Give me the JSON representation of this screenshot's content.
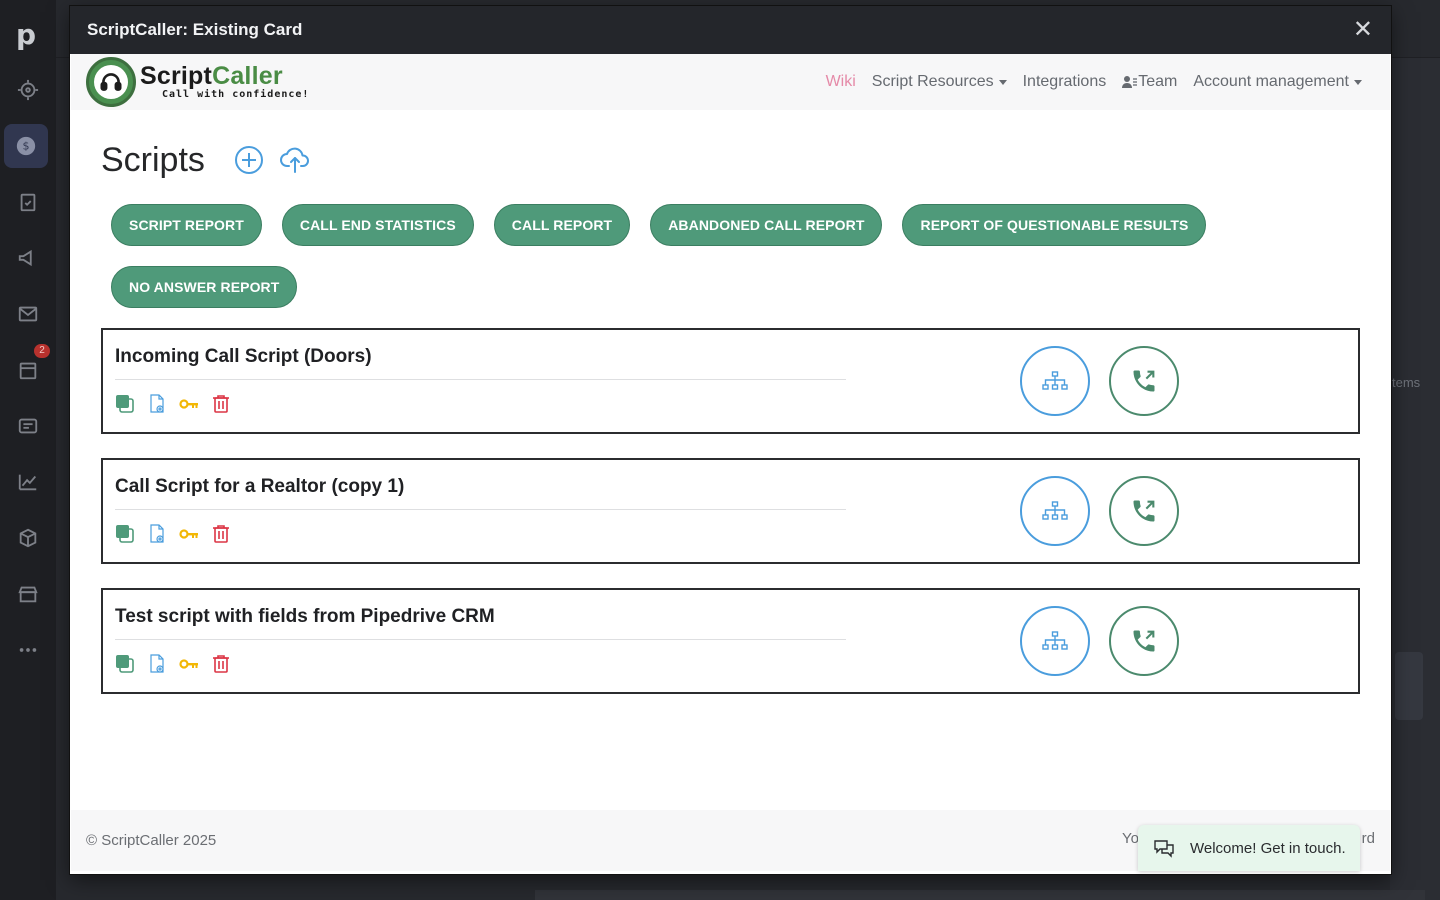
{
  "background": {
    "logo": "p",
    "badge": "2",
    "right_text": "tems"
  },
  "modal": {
    "title": "ScriptCaller: Existing Card",
    "close": "✕"
  },
  "brand": {
    "name_a": "Script",
    "name_b": "Caller",
    "tagline": "Call with confidence!"
  },
  "nav": {
    "wiki": "Wiki",
    "script_resources": "Script Resources",
    "integrations": "Integrations",
    "team": "Team",
    "account": "Account management"
  },
  "page": {
    "title": "Scripts"
  },
  "reports": [
    "SCRIPT REPORT",
    "CALL END STATISTICS",
    "CALL REPORT",
    "ABANDONED CALL REPORT",
    "REPORT OF QUESTIONABLE RESULTS",
    "NO ANSWER REPORT"
  ],
  "scripts": [
    {
      "title": "Incoming Call Script (Doors)"
    },
    {
      "title": "Call Script for a Realtor (copy 1)"
    },
    {
      "title": "Test script with fields from Pipedrive CRM"
    }
  ],
  "footer": {
    "copyright": "© ScriptCaller 2025",
    "left_fragment": "Yo",
    "right_fragment": "rd"
  },
  "chat": {
    "text": "Welcome! Get in touch."
  },
  "colors": {
    "report_button": "#4f9a7a",
    "flow_button_border": "#4a9ddd",
    "call_button_border": "#4b8a6d",
    "wiki_link": "#e58aa8",
    "delete_icon": "#dc3545",
    "key_icon": "#f2b705"
  },
  "icons": {
    "add": "plus-circle-icon",
    "upload": "cloud-upload-icon",
    "copy": "copy-icon",
    "file": "file-settings-icon",
    "key": "key-icon",
    "delete": "trash-icon",
    "flow": "sitemap-icon",
    "call": "phone-outgoing-icon",
    "chat": "chat-icon"
  }
}
